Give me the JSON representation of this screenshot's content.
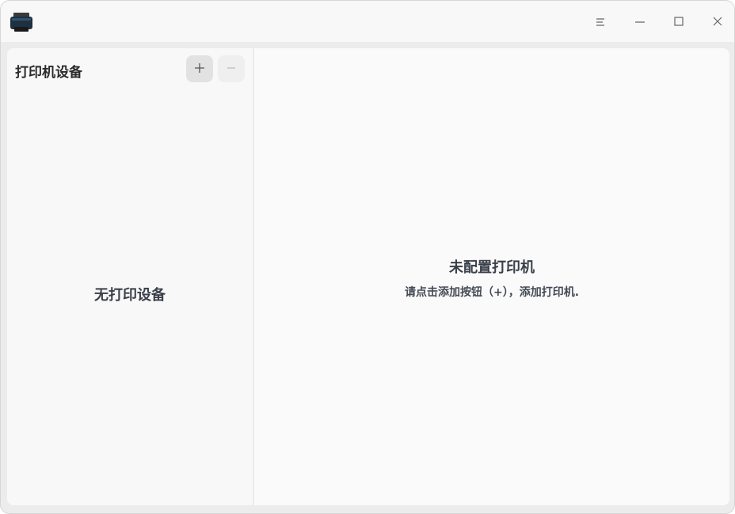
{
  "titlebar": {
    "icons": [
      "printer-app-icon",
      "menu-icon",
      "minimize-icon",
      "maximize-icon",
      "close-icon"
    ]
  },
  "sidebar": {
    "title": "打印机设备",
    "add_label": "+",
    "remove_label": "−",
    "empty_text": "无打印设备"
  },
  "main": {
    "empty_title": "未配置打印机",
    "empty_hint": "请点击添加按钮（+），添加打印机."
  },
  "colors": {
    "window_bg": "#ececec",
    "panel_bg": "#f8f8f8",
    "text_dark": "#3a3f4a"
  }
}
